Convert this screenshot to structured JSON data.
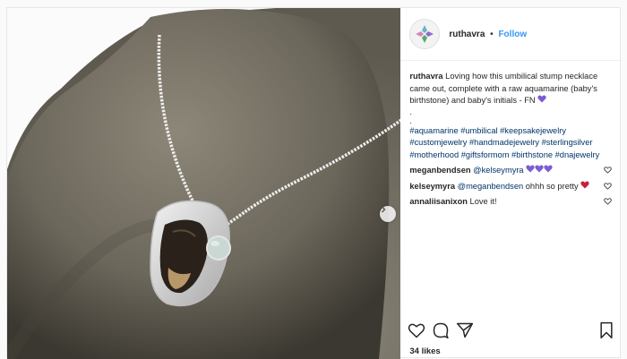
{
  "author": {
    "username": "ruthavra",
    "follow_label": "Follow",
    "separator": "•"
  },
  "caption": {
    "username": "ruthavra",
    "text": "Loving how this umbilical stump necklace came out, complete with a raw aquamarine (baby's birthstone) and baby's initials - FN",
    "emoji": "purple-heart",
    "dots": [
      ".",
      "."
    ],
    "hashtags": "#aquamarine #umbilical #keepsakejewelry #customjewelry #handmadejewelry #sterlingsilver #motherhood #giftsformom #birthstone #dnajewelry"
  },
  "comments": [
    {
      "username": "meganbendsen",
      "mention": "@kelseymyra",
      "text": "",
      "emoji": "purple-heart x3"
    },
    {
      "username": "kelseymyra",
      "mention": "@meganbendsen",
      "text": "ohhh so pretty",
      "emoji": "red-heart"
    },
    {
      "username": "annaliisanixon",
      "mention": "",
      "text": "Love it!",
      "emoji": ""
    }
  ],
  "likes": "34 likes",
  "colors": {
    "link": "#3897f0",
    "hashtag": "#003569",
    "purple_heart": "#7a5cd6",
    "red_heart": "#c81e3c"
  },
  "icons": [
    "heart-icon",
    "comment-icon",
    "share-icon",
    "bookmark-icon",
    "chevron-right-icon"
  ]
}
